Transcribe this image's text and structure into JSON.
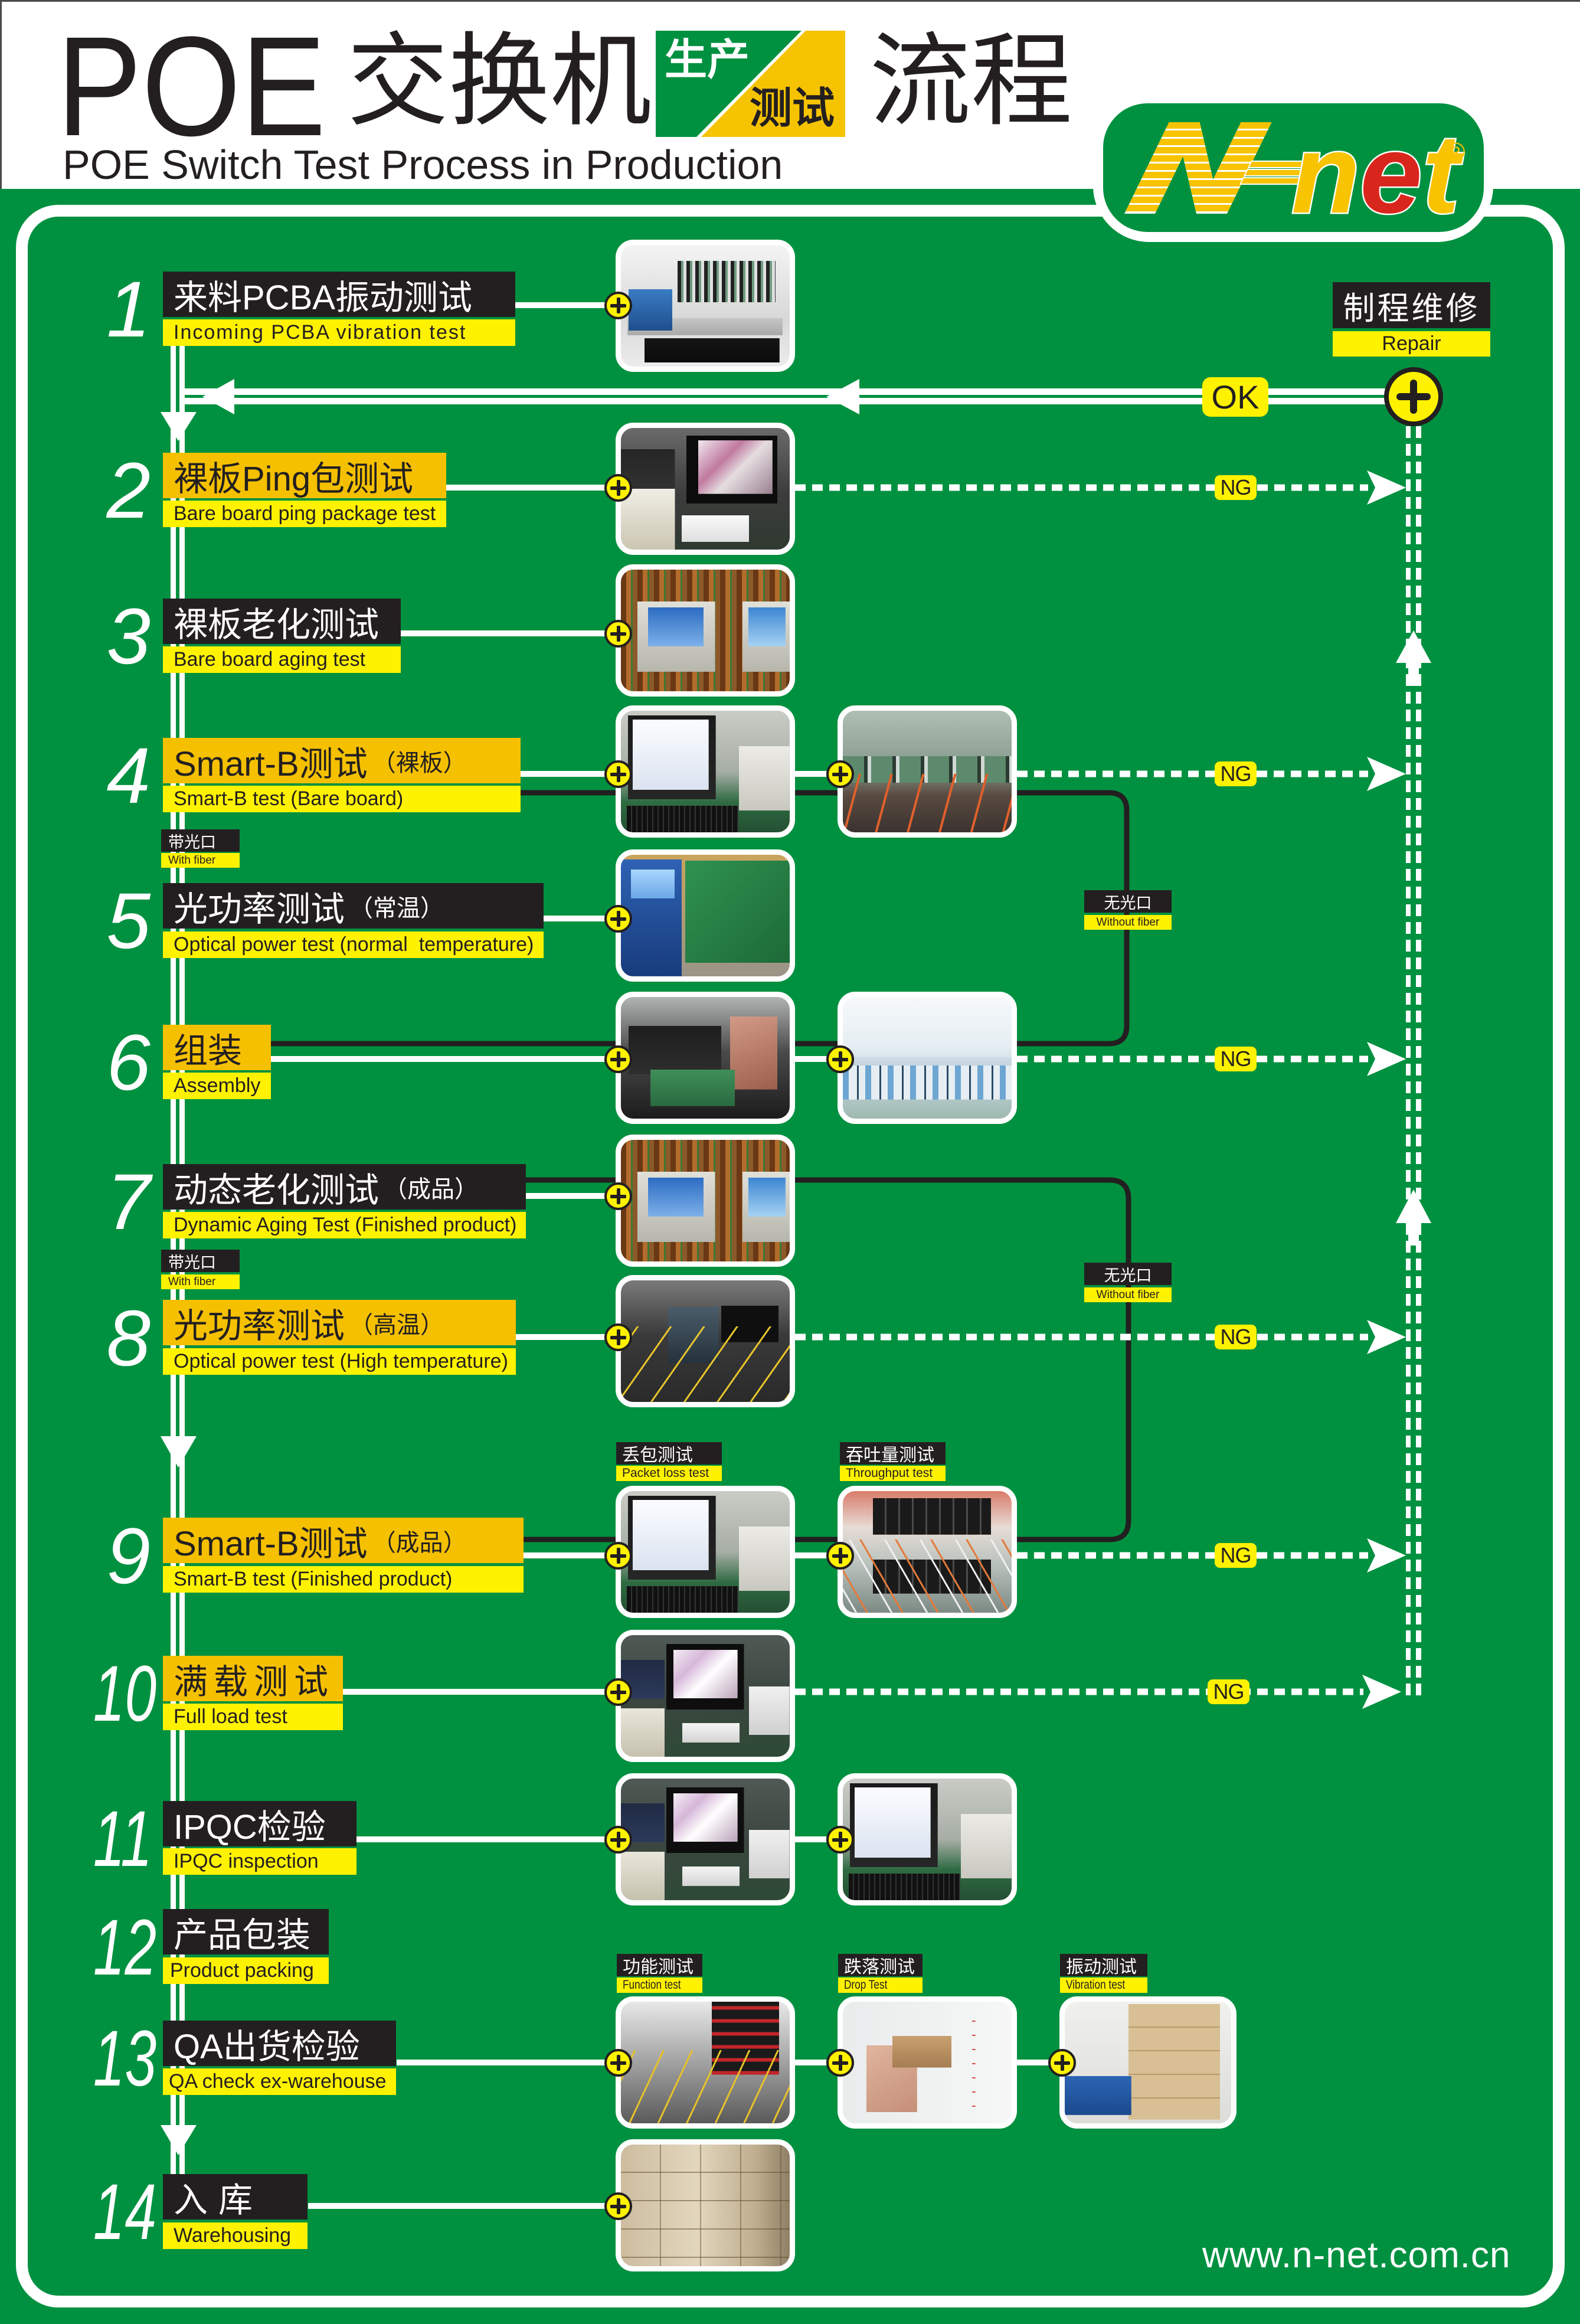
{
  "header": {
    "title_prefix": "POE",
    "title_cn": "交换机",
    "badge_top": "生产",
    "badge_bottom": "测试",
    "title_suffix": "流程",
    "subtitle": "POE Switch Test Process in Production"
  },
  "logo": {
    "wordmark": "N-net",
    "letters": [
      "n",
      "e",
      "t"
    ],
    "registered_mark": "®"
  },
  "repair": {
    "title_cn": "制程维修",
    "title_en": "Repair"
  },
  "flow_labels": {
    "ok": "OK",
    "ng": "NG"
  },
  "branches": {
    "with_fiber": {
      "cn": "带光口",
      "en": "With fiber"
    },
    "without_fiber": {
      "cn": "无光口",
      "en": "Without fiber"
    }
  },
  "steps": [
    {
      "number": "1",
      "title_cn": "来料PCBA振动测试",
      "title_en": "Incoming PCBA vibration test"
    },
    {
      "number": "2",
      "title_cn": "裸板Ping包测试",
      "title_en": "Bare board ping package test"
    },
    {
      "number": "3",
      "title_cn": "裸板老化测试",
      "title_en": "Bare board aging test"
    },
    {
      "number": "4",
      "title_cn": "Smart-B测试",
      "note_cn": "（裸板）",
      "title_en": "Smart-B test (Bare board)"
    },
    {
      "number": "5",
      "title_cn": "光功率测试",
      "note_cn": "（常温）",
      "title_en": "Optical power test (normal  temperature)"
    },
    {
      "number": "6",
      "title_cn": "组装",
      "title_en": "Assembly"
    },
    {
      "number": "7",
      "title_cn": "动态老化测试",
      "note_cn": "（成品）",
      "title_en": "Dynamic Aging Test (Finished product)"
    },
    {
      "number": "8",
      "title_cn": "光功率测试",
      "note_cn": "（高温）",
      "title_en": "Optical power test (High temperature)"
    },
    {
      "number": "9",
      "title_cn": "Smart-B测试",
      "note_cn": "（成品）",
      "title_en": "Smart-B test (Finished product)",
      "sub_tests": [
        {
          "cn": "丢包测试",
          "en": "Packet loss test"
        },
        {
          "cn": "吞吐量测试",
          "en": "Throughput test"
        }
      ]
    },
    {
      "number": "10",
      "title_cn": "满载测试",
      "title_en": "Full load test"
    },
    {
      "number": "11",
      "title_cn": "IPQC检验",
      "title_en": "IPQC inspection"
    },
    {
      "number": "12",
      "title_cn": "产品包装",
      "title_en": "Product packing"
    },
    {
      "number": "13",
      "title_cn": "QA出货检验",
      "title_en": "QA check ex-warehouse",
      "sub_tests": [
        {
          "cn": "功能测试",
          "en": "Function test"
        },
        {
          "cn": "跌落测试",
          "en": "Drop Test"
        },
        {
          "cn": "振动测试",
          "en": "Vibration test"
        }
      ]
    },
    {
      "number": "14",
      "title_cn": "入库",
      "title_en": "Warehousing"
    }
  ],
  "footer": {
    "url": "www.n-net.com.cn"
  },
  "icons": {
    "junction": "plus-circle-icon",
    "flow_arrow": "arrow-icon"
  },
  "colors": {
    "green": "#009140",
    "dark": "#231f20",
    "orange": "#f5c000",
    "yellow": "#fff200",
    "white": "#ffffff",
    "badge_yellow": "#f6c300",
    "logo_yellow": "#f8c300",
    "logo_red": "#d9261c"
  }
}
